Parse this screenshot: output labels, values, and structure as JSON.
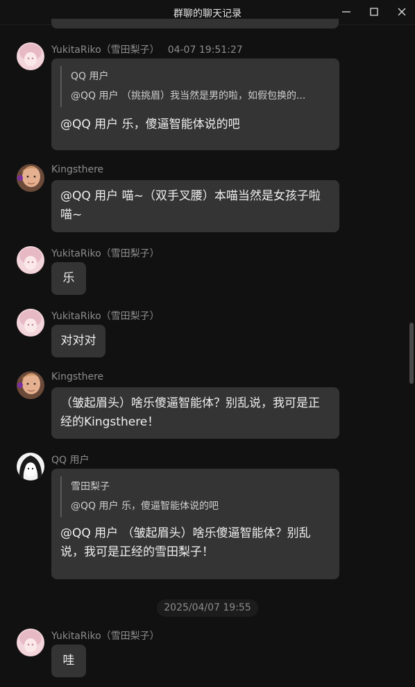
{
  "window": {
    "title": "群聊的聊天记录",
    "controls": [
      "minimize-icon",
      "maximize-icon",
      "close-icon"
    ]
  },
  "messages": [
    {
      "sender": "YukitaRiko（雪田梨子）",
      "time": "04-07 19:51:27",
      "avatar": "anime-girl-pink-avatar",
      "quote": {
        "name": "QQ 用户",
        "text": "@QQ 用户 （挑挑眉）我当然是男的啦，如假包换的..."
      },
      "text": "@QQ 用户 乐，傻逼智能体说的吧"
    },
    {
      "sender": "Kingsthere",
      "avatar": "man-photo-avatar",
      "text": "@QQ 用户 喵~（双手叉腰）本喵当然是女孩子啦喵~"
    },
    {
      "sender": "YukitaRiko（雪田梨子）",
      "avatar": "anime-girl-pink-avatar",
      "text": "乐"
    },
    {
      "sender": "YukitaRiko（雪田梨子）",
      "avatar": "anime-girl-pink-avatar",
      "text": "对对对"
    },
    {
      "sender": "Kingsthere",
      "avatar": "man-photo-avatar",
      "text": "（皱起眉头）啥乐傻逼智能体？别乱说，我可是正经的Kingsthere！"
    },
    {
      "sender": "QQ 用户",
      "avatar": "manga-girl-avatar",
      "quote": {
        "name": "雪田梨子",
        "text": "@QQ 用户 乐，傻逼智能体说的吧"
      },
      "text": "@QQ 用户 （皱起眉头）啥乐傻逼智能体？别乱说，我可是正经的雪田梨子！"
    },
    {
      "sender": "YukitaRiko（雪田梨子）",
      "avatar": "anime-girl-pink-avatar",
      "text": "哇"
    }
  ],
  "date_separator": "2025/04/07 19:55",
  "colors": {
    "background": "#111111",
    "bubble": "#343434",
    "sender_text": "#8d8d8d",
    "message_text": "#f0f0f0"
  }
}
